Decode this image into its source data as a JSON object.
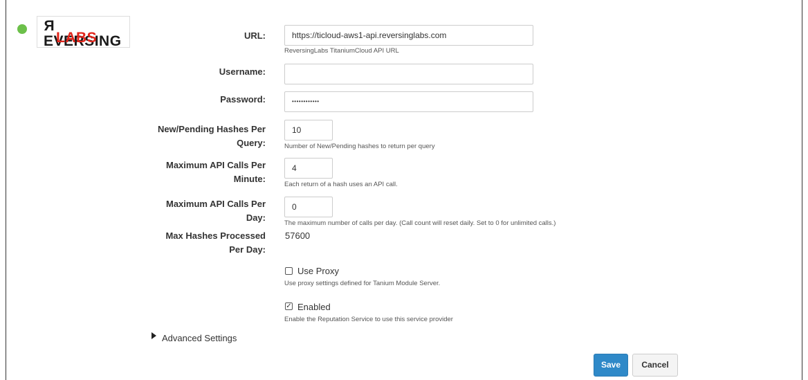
{
  "provider": {
    "logo_text_top": "REVERSING",
    "logo_text_bottom": "LABS",
    "status_color": "#6cc04a",
    "brand_red": "#e1251b"
  },
  "form": {
    "url": {
      "label": "URL:",
      "value": "https://ticloud-aws1-api.reversinglabs.com",
      "help": "ReversingLabs TitaniumCloud API URL"
    },
    "username": {
      "label": "Username:",
      "value": ""
    },
    "password": {
      "label": "Password:",
      "value": "••••••••••••"
    },
    "hashes_per_query": {
      "label_line1": "New/Pending Hashes Per",
      "label_line2": "Query:",
      "value": "10",
      "help": "Number of New/Pending hashes to return per query"
    },
    "calls_per_minute": {
      "label_line1": "Maximum API Calls Per",
      "label_line2": "Minute:",
      "value": "4",
      "help": "Each return of a hash uses an API call."
    },
    "calls_per_day": {
      "label_line1": "Maximum API Calls Per",
      "label_line2": "Day:",
      "value": "0",
      "help": "The maximum number of calls per day. (Call count will reset daily. Set to 0 for unlimited calls.)"
    },
    "max_hashes_per_day": {
      "label_line1": "Max Hashes Processed",
      "label_line2": "Per Day:",
      "value": "57600"
    },
    "use_proxy": {
      "label": "Use Proxy",
      "checked": false,
      "help": "Use proxy settings defined for Tanium Module Server."
    },
    "enabled": {
      "label": "Enabled",
      "checked": true,
      "help": "Enable the Reputation Service to use this service provider"
    },
    "advanced_settings_label": "Advanced Settings"
  },
  "actions": {
    "save_label": "Save",
    "cancel_label": "Cancel"
  }
}
